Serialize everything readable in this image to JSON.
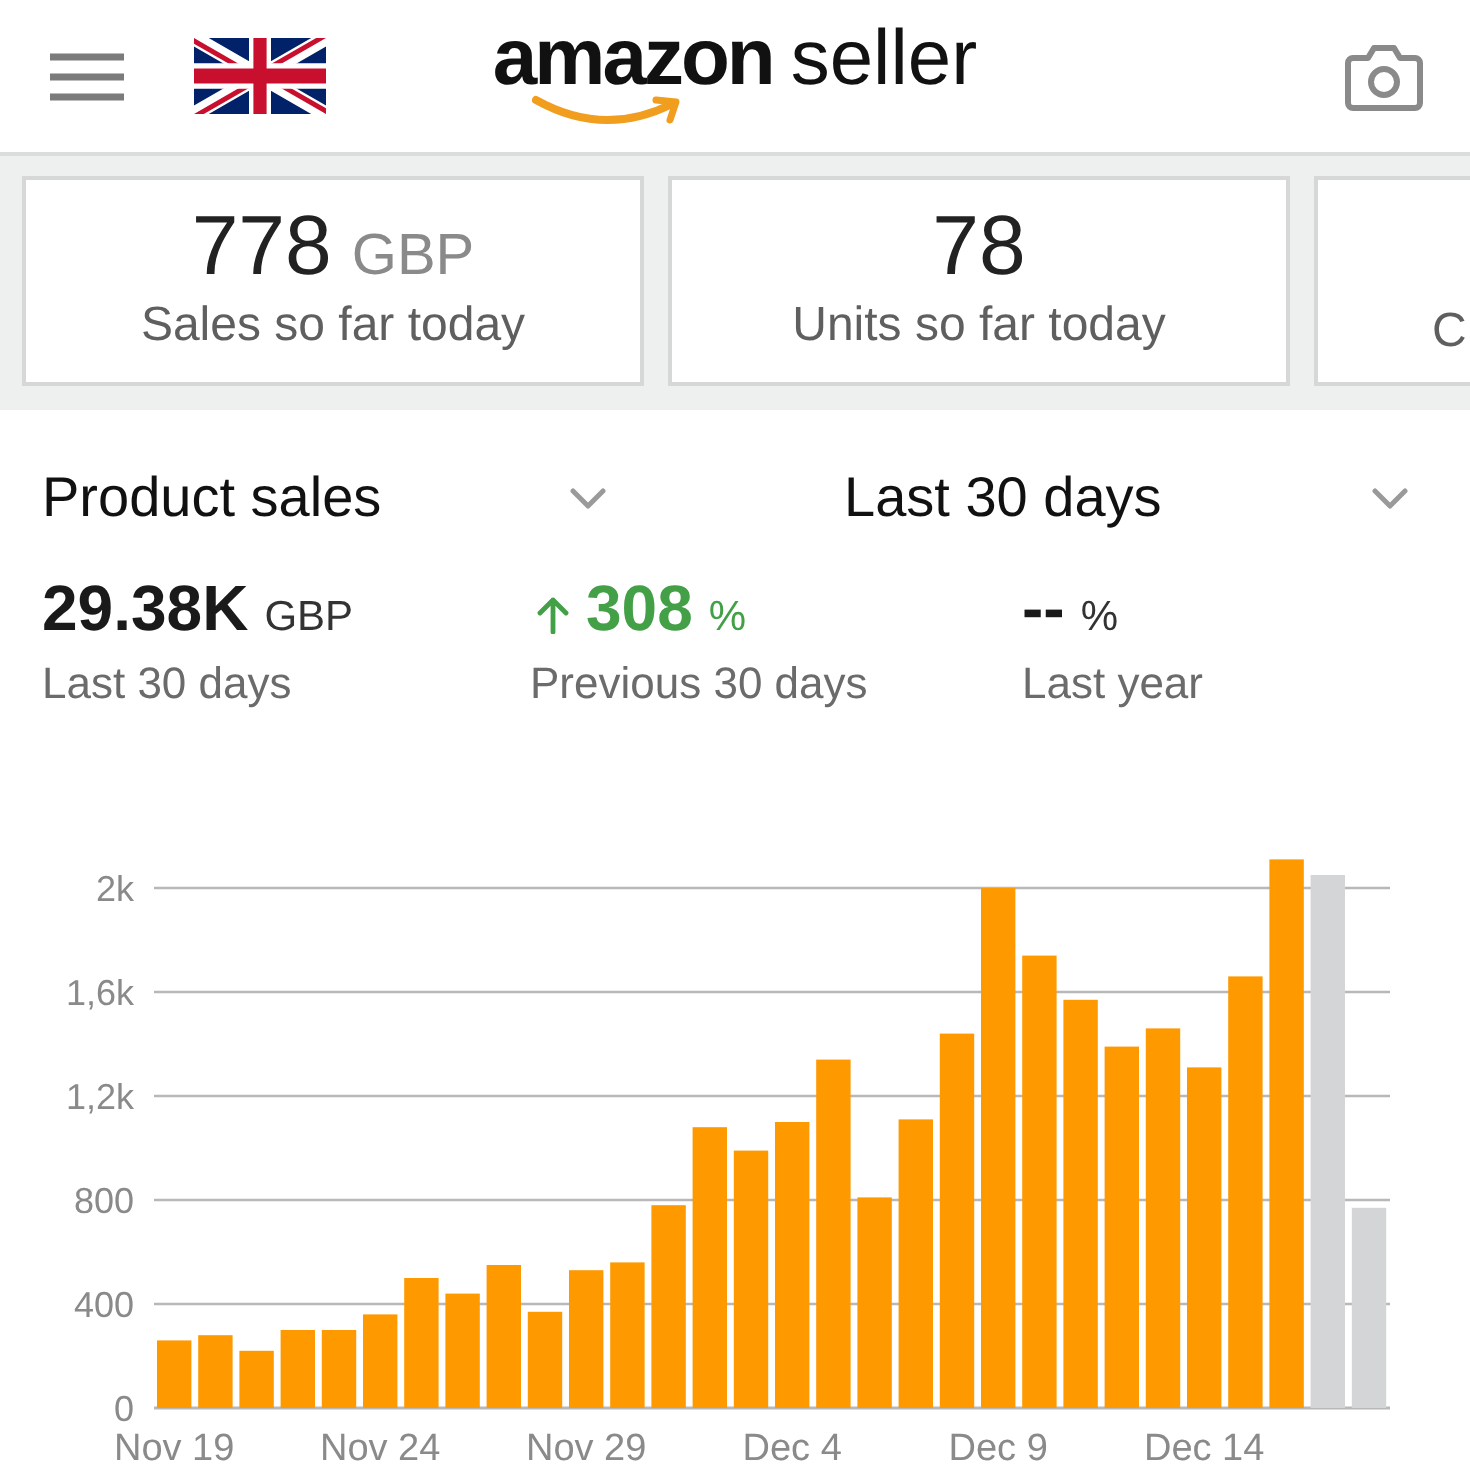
{
  "header": {
    "logo": {
      "wordmark": "amazon",
      "product": "seller"
    }
  },
  "summary_cards": [
    {
      "value": "778",
      "unit": "GBP",
      "label": "Sales so far today",
      "cut_off": false
    },
    {
      "value": "78",
      "label": "Units so far today",
      "cut_off": false
    },
    {
      "label": "C",
      "cut_off": true
    }
  ],
  "filters": [
    {
      "label": "Product sales"
    },
    {
      "label": "Last 30 days"
    }
  ],
  "metrics": [
    {
      "value": "29.38K",
      "unit": "GBP",
      "label": "Last 30 days",
      "increase": false
    },
    {
      "value": "308",
      "unit": "%",
      "label": "Previous 30 days",
      "increase": true
    },
    {
      "value": "--",
      "unit": "%",
      "label": "Last year",
      "increase": false
    }
  ],
  "chart": {
    "chart_data": {
      "type": "bar",
      "categories": [
        "Nov 19",
        null,
        null,
        null,
        null,
        "Nov 24",
        null,
        null,
        null,
        null,
        "Nov 29",
        null,
        null,
        null,
        null,
        "Dec 4",
        null,
        null,
        null,
        null,
        "Dec 9",
        null,
        null,
        null,
        null,
        "Dec 14",
        null,
        null,
        null,
        null
      ],
      "series": [
        {
          "color": "#ff9900",
          "values": [
            260,
            280,
            220,
            300,
            300,
            360,
            500,
            440,
            550,
            370,
            530,
            560,
            780,
            1080,
            990,
            1100,
            1340,
            810,
            1110,
            1440,
            2000,
            1740,
            1570,
            1390,
            1460,
            1310,
            1660,
            2110,
            null,
            null
          ]
        },
        {
          "color": "#d4d5d6",
          "values": [
            null,
            null,
            null,
            null,
            null,
            null,
            null,
            null,
            null,
            null,
            null,
            null,
            null,
            null,
            null,
            null,
            null,
            null,
            null,
            null,
            null,
            null,
            null,
            null,
            null,
            null,
            null,
            null,
            2050,
            770
          ]
        }
      ],
      "ylim": [
        0,
        2110
      ],
      "yticks": [
        0,
        400,
        800,
        {
          "value": 1200,
          "label": "1,2k"
        },
        {
          "value": 1600,
          "label": "1,6k"
        },
        {
          "value": 2000,
          "label": "2k"
        }
      ],
      "grid": true
    }
  }
}
